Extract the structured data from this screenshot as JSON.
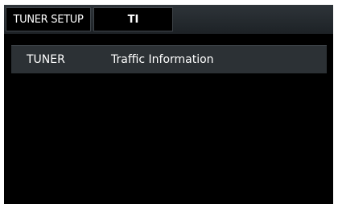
{
  "header": {
    "tabs": [
      {
        "label": "TUNER SETUP"
      },
      {
        "label": "TI"
      }
    ]
  },
  "list": {
    "items": [
      {
        "category": "TUNER",
        "value": "Traffic Information"
      }
    ]
  }
}
